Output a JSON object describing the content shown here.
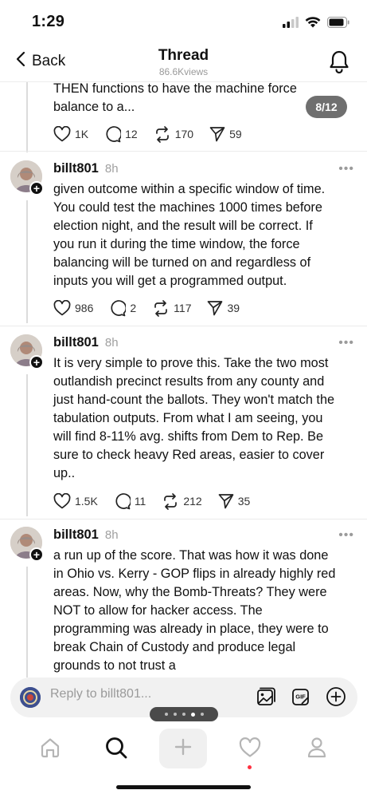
{
  "status_bar": {
    "time": "1:29"
  },
  "nav": {
    "back_label": "Back",
    "title": "Thread",
    "views": "86.6Kviews"
  },
  "thread": {
    "page_indicator": "8/12",
    "first_post": {
      "text_lines": [
        "THEN functions to have the machine force",
        "balance to a..."
      ],
      "likes": "1K",
      "replies": "12",
      "reposts": "170",
      "shares": "59"
    },
    "posts": [
      {
        "username": "billt801",
        "time": "8h",
        "more": "•••",
        "text_lines": [
          "given outcome within a specific window of time.",
          "You could test the machines 1000 times before",
          "election night, and the result will be correct. If",
          "you run it during the time window, the force",
          "balancing will be turned on and regardless of",
          "inputs you will get a programmed output."
        ],
        "likes": "986",
        "replies": "2",
        "reposts": "117",
        "shares": "39"
      },
      {
        "username": "billt801",
        "time": "8h",
        "more": "•••",
        "text_lines": [
          "It is very simple to prove this. Take the two most",
          "outlandish precinct results from any county and",
          "just hand-count the ballots. They won't match the",
          "tabulation outputs. From what I am seeing, you",
          "will find 8-11% avg. shifts from Dem to Rep. Be",
          "sure to check heavy Red areas, easier to cover",
          "up.."
        ],
        "likes": "1.5K",
        "replies": "11",
        "reposts": "212",
        "shares": "35"
      },
      {
        "username": "billt801",
        "time": "8h",
        "more": "•••",
        "text_lines": [
          "a run up of the score. That was how it was done",
          "in Ohio vs. Kerry - GOP flips in already highly red",
          "areas. Now, why the Bomb-Threats? They were",
          "NOT to allow for hacker access. The",
          "programming was already in place, they were to",
          "break Chain of Custody and produce legal",
          "grounds to not trust a"
        ]
      }
    ]
  },
  "reply_bar": {
    "placeholder": "Reply to billt801..."
  },
  "icons": {
    "status": [
      "signal-icon",
      "wifi-icon",
      "battery-icon"
    ],
    "nav": [
      "chevron-left-icon",
      "bell-icon"
    ],
    "actions": [
      "heart-icon",
      "comment-icon",
      "repost-icon",
      "send-icon"
    ],
    "reply": [
      "image-icon",
      "gif-icon",
      "add-circle-icon"
    ],
    "tabs": [
      "home-icon",
      "search-icon",
      "plus-icon",
      "heart-icon",
      "profile-icon"
    ]
  },
  "colors": {
    "notification_dot": "#ff3040",
    "badge_bg": "#6f6f6f"
  }
}
